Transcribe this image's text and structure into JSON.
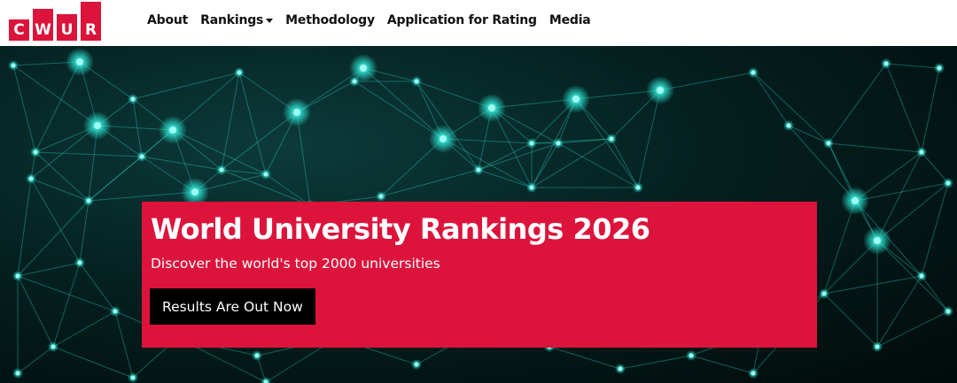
{
  "logo": {
    "letters": [
      "C",
      "W",
      "U",
      "R"
    ],
    "color": "#dc143c"
  },
  "nav": {
    "items": [
      {
        "label": "About"
      },
      {
        "label": "Rankings",
        "has_dropdown": true
      },
      {
        "label": "Methodology"
      },
      {
        "label": "Application for Rating"
      },
      {
        "label": "Media"
      }
    ]
  },
  "hero": {
    "title": "World University Rankings 2026",
    "subtitle": "Discover the world's top 2000 universities",
    "button_label": "Results Are Out Now",
    "banner_color": "#dc143c",
    "network_color": "#2ee6d6"
  }
}
